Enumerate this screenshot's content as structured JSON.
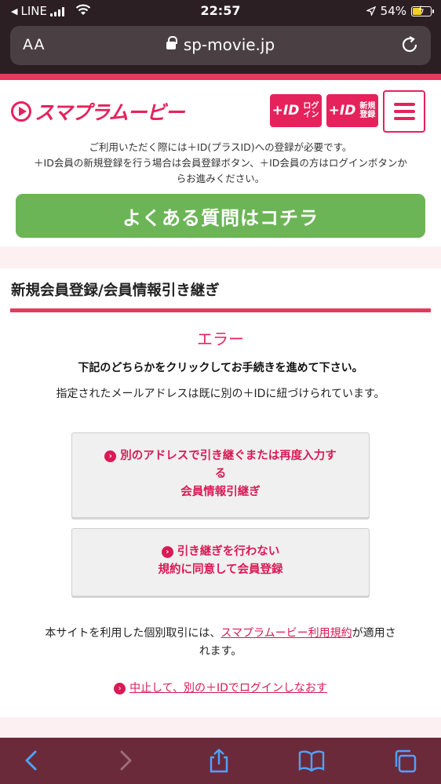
{
  "status_bar": {
    "back_app": "LINE",
    "time": "22:57",
    "battery": "54%"
  },
  "browser": {
    "aa_label": "AA",
    "url": "sp-movie.jp"
  },
  "header": {
    "logo": "スマプラムービー",
    "login_plus": "+ID",
    "login_label": "ログイン",
    "register_plus": "+ID",
    "register_label": "新規登録"
  },
  "notice": {
    "line1": "ご利用いただく際には＋ID(プラスID)への登録が必要です。",
    "line2": "＋ID会員の新規登録を行う場合は会員登録ボタン、＋ID会員の方はログインボタンか",
    "line3": "らお進みください。"
  },
  "faq_button": "よくある質問はコチラ",
  "section_title": "新規会員登録/会員情報引き継ぎ",
  "error": {
    "heading": "エラー",
    "instruction": "下記のどちらかをクリックしてお手続きを進めて下さい。",
    "message": "指定されたメールアドレスは既に別の＋IDに紐づけられています。"
  },
  "buttons": {
    "transfer_line1": "別のアドレスで引き継ぐまたは再度入力す",
    "transfer_line2": "る",
    "transfer_line3": "会員情報引継ぎ",
    "register_line1": "引き継ぎを行わない",
    "register_line2": "規約に同意して会員登録"
  },
  "terms": {
    "before": "本サイトを利用した個別取引には、",
    "link": "スマプラムービー利用規約",
    "after1": "が適用さ",
    "after2": "れます。"
  },
  "cancel_link": "中止して、別の＋IDでログインしなおす",
  "colors": {
    "brand": "#e5225c",
    "accent_bar": "#e33a5e",
    "faq_green": "#6cb556",
    "toolbar": "#6b2a3a"
  }
}
